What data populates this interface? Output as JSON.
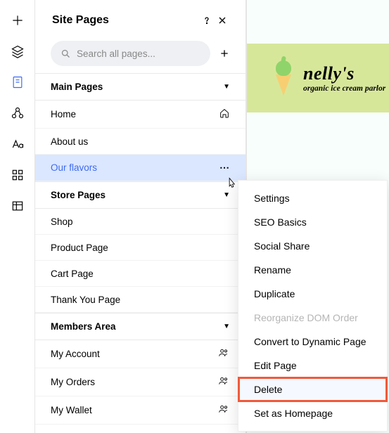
{
  "panel": {
    "title": "Site Pages",
    "search_placeholder": "Search all pages..."
  },
  "sections": {
    "main": {
      "title": "Main Pages"
    },
    "store": {
      "title": "Store Pages"
    },
    "members": {
      "title": "Members Area"
    }
  },
  "pages": {
    "home": "Home",
    "about": "About us",
    "flavors": "Our flavors",
    "shop": "Shop",
    "product": "Product Page",
    "cart": "Cart Page",
    "thankyou": "Thank You Page",
    "account": "My Account",
    "orders": "My Orders",
    "wallet": "My Wallet"
  },
  "menu": {
    "settings": "Settings",
    "seo": "SEO Basics",
    "social": "Social Share",
    "rename": "Rename",
    "duplicate": "Duplicate",
    "reorg": "Reorganize DOM Order",
    "convert": "Convert to Dynamic Page",
    "edit": "Edit Page",
    "delete": "Delete",
    "homepage": "Set as Homepage"
  },
  "brand": {
    "name": "nelly's",
    "tagline": "organic ice cream parlor"
  }
}
